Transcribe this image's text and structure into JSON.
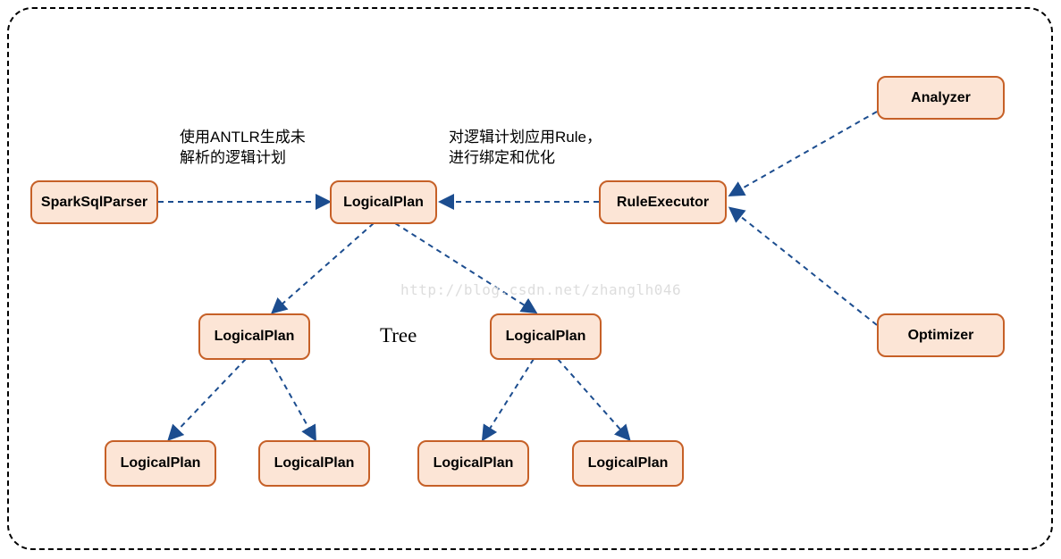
{
  "nodes": {
    "sparkSqlParser": "SparkSqlParser",
    "logicalPlanRoot": "LogicalPlan",
    "ruleExecutor": "RuleExecutor",
    "analyzer": "Analyzer",
    "optimizer": "Optimizer",
    "logicalPlanL": "LogicalPlan",
    "logicalPlanR": "LogicalPlan",
    "logicalPlanLL": "LogicalPlan",
    "logicalPlanLR": "LogicalPlan",
    "logicalPlanRL": "LogicalPlan",
    "logicalPlanRR": "LogicalPlan"
  },
  "annotations": {
    "left": "使用ANTLR生成未\n解析的逻辑计划",
    "right": "对逻辑计划应用Rule，\n进行绑定和优化"
  },
  "labels": {
    "tree": "Tree"
  },
  "watermark": "http://blog.csdn.net/zhanglh046",
  "colors": {
    "nodeFill": "#fce5d6",
    "nodeBorder": "#c66027",
    "arrowStroke": "#1c4d8f"
  }
}
